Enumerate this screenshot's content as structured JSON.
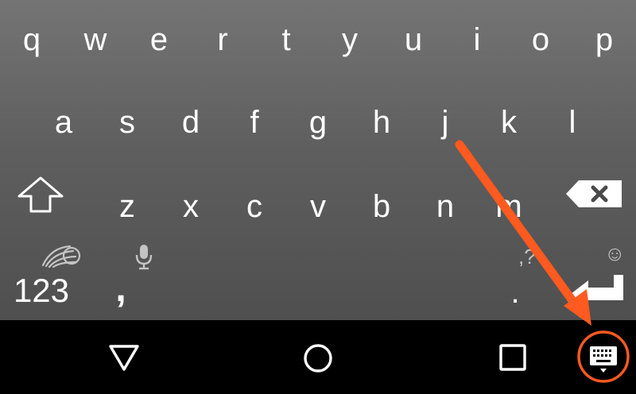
{
  "keyboard": {
    "row1": [
      "q",
      "w",
      "e",
      "r",
      "t",
      "y",
      "u",
      "i",
      "o",
      "p"
    ],
    "row2": [
      "a",
      "s",
      "d",
      "f",
      "g",
      "h",
      "j",
      "k",
      "l"
    ],
    "row3": [
      "z",
      "x",
      "c",
      "v",
      "b",
      "n",
      "m"
    ],
    "bottom": {
      "numbers_label": "123",
      "comma_label": ",",
      "period_label": ".",
      "punct_hint": ",?",
      "emoji_hint": "☺"
    },
    "icons": {
      "shift": "shift-arrow-icon",
      "backspace": "backspace-icon",
      "swiftkey": "swiftkey-logo-icon",
      "mic": "microphone-icon",
      "enter": "enter-icon"
    }
  },
  "navbar": {
    "icons": [
      "back-triangle-icon",
      "home-circle-icon",
      "recents-square-icon",
      "keyboard-switch-icon"
    ]
  },
  "annotation": {
    "color": "#ff5a1f"
  },
  "colors": {
    "key_text": "#ffffff",
    "hint_text": "#c4c4c4",
    "navbar_bg": "#000000"
  }
}
